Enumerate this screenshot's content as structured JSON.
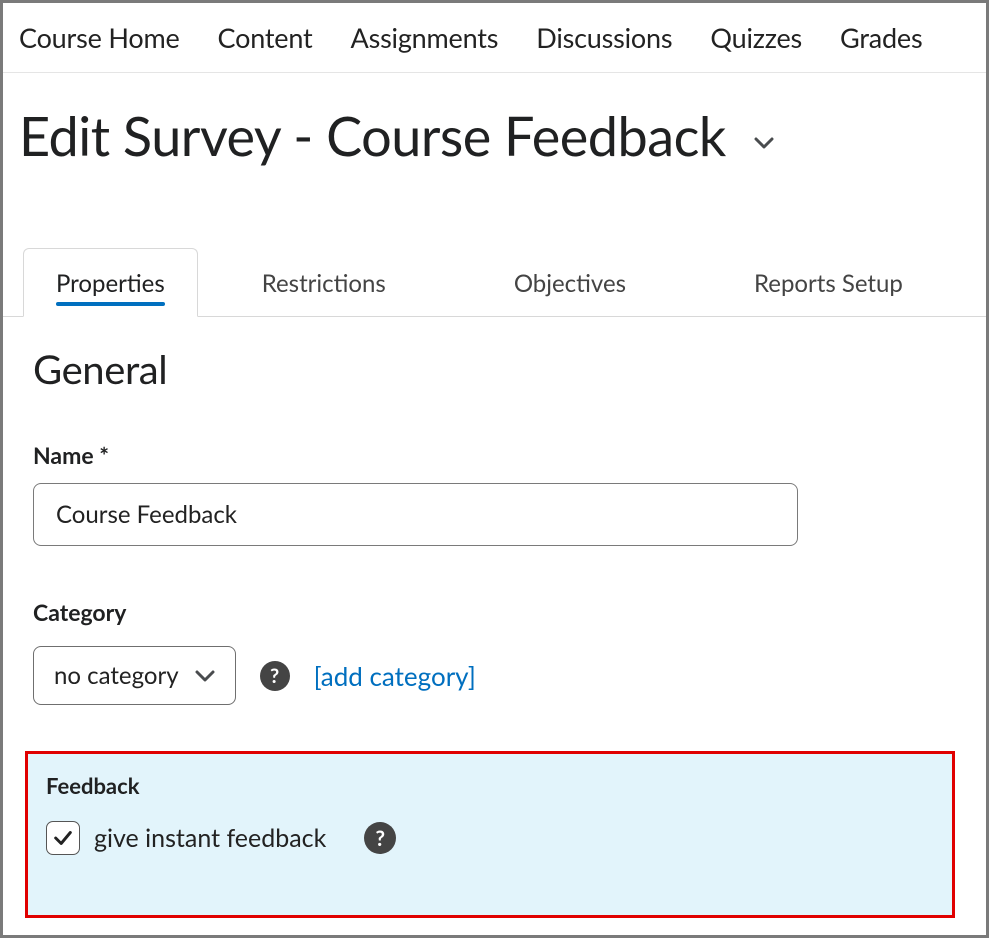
{
  "nav": {
    "items": [
      {
        "label": "Course Home"
      },
      {
        "label": "Content"
      },
      {
        "label": "Assignments"
      },
      {
        "label": "Discussions"
      },
      {
        "label": "Quizzes"
      },
      {
        "label": "Grades"
      }
    ]
  },
  "page": {
    "title": "Edit Survey - Course Feedback"
  },
  "tabs": [
    {
      "label": "Properties",
      "active": true
    },
    {
      "label": "Restrictions",
      "active": false
    },
    {
      "label": "Objectives",
      "active": false
    },
    {
      "label": "Reports Setup",
      "active": false
    }
  ],
  "general": {
    "heading": "General",
    "name_label": "Name *",
    "name_value": "Course Feedback",
    "category_label": "Category",
    "category_selected": "no category",
    "add_category_label": "[add category]"
  },
  "feedback": {
    "heading": "Feedback",
    "instant_label": "give instant feedback",
    "instant_checked": true
  },
  "icons": {
    "help_glyph": "?"
  }
}
